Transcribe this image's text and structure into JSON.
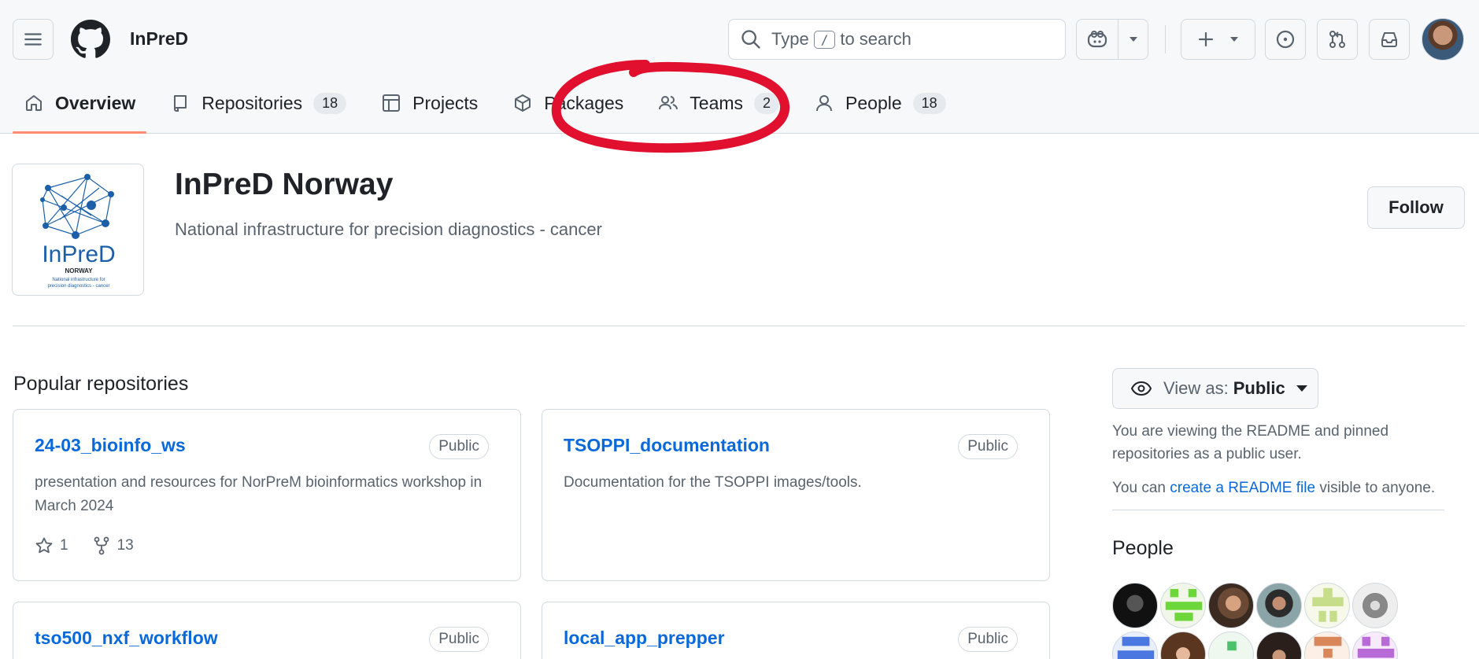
{
  "header": {
    "org_name": "InPreD",
    "search": {
      "prefix": "Type",
      "key": "/",
      "suffix": "to search"
    }
  },
  "tabs": [
    {
      "label": "Overview",
      "count": null,
      "icon": "home-icon"
    },
    {
      "label": "Repositories",
      "count": "18",
      "icon": "repo-icon"
    },
    {
      "label": "Projects",
      "count": null,
      "icon": "table-icon"
    },
    {
      "label": "Packages",
      "count": null,
      "icon": "package-icon"
    },
    {
      "label": "Teams",
      "count": "2",
      "icon": "people-icon"
    },
    {
      "label": "People",
      "count": "18",
      "icon": "person-icon"
    }
  ],
  "profile": {
    "title": "InPreD Norway",
    "description": "National infrastructure for precision diagnostics - cancer",
    "follow_label": "Follow",
    "logo": {
      "name": "InPreD",
      "sub": "NORWAY",
      "tag1": "National infrastructure for",
      "tag2": "precision diagnostics - cancer"
    }
  },
  "popular": {
    "title": "Popular repositories",
    "repos": [
      {
        "name": "24-03_bioinfo_ws",
        "visibility": "Public",
        "description": "presentation and resources for NorPreM bioinformatics workshop in March 2024",
        "stars": "1",
        "forks": "13"
      },
      {
        "name": "TSOPPI_documentation",
        "visibility": "Public",
        "description": "Documentation for the TSOPPI images/tools.",
        "stars": "",
        "forks": ""
      },
      {
        "name": "tso500_nxf_workflow",
        "visibility": "Public",
        "description": "",
        "stars": "",
        "forks": ""
      },
      {
        "name": "local_app_prepper",
        "visibility": "Public",
        "description": "",
        "stars": "",
        "forks": ""
      }
    ]
  },
  "sidebar": {
    "view_as_prefix": "View as:",
    "view_as_value": "Public",
    "readme_note": "You are viewing the README and pinned repositories as a public user.",
    "create_prefix": "You can ",
    "create_link": "create a README file",
    "create_suffix": " visible to anyone.",
    "people_title": "People"
  },
  "colors": {
    "accent": "#0969da",
    "tab_underline": "#fd8c73",
    "annotation": "#e0102e"
  }
}
